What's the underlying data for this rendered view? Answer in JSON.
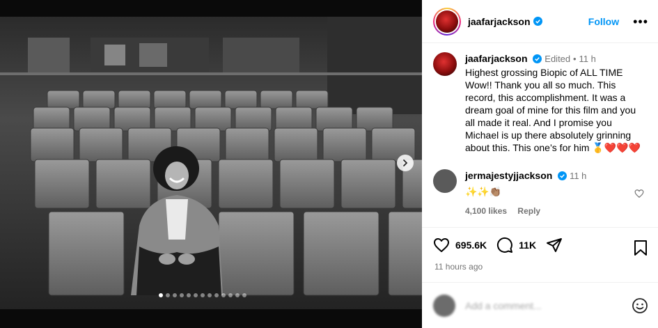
{
  "post": {
    "username": "jaafarjackson",
    "follow_label": "Follow",
    "more_label": "•••"
  },
  "caption": {
    "username": "jaafarjackson",
    "edited": "Edited",
    "separator": "•",
    "time": "11 h",
    "text": "Highest grossing Biopic of ALL TIME Wow!! Thank you all so much. This record, this accomplishment. It was a dream goal of mine for this film and you all made it real. And I promise you Michael is up there absolutely grinning about this. This one’s for him 🥇❤️❤️❤️"
  },
  "comment": {
    "username": "jermajestyjjackson",
    "time": "11 h",
    "text": "✨✨👏🏽",
    "likes": "4,100 likes",
    "reply_label": "Reply"
  },
  "actions": {
    "likes": "695.6K",
    "comments": "11K"
  },
  "timestamp": "11 hours ago",
  "add_comment": {
    "placeholder": "Add a comment..."
  },
  "carousel": {
    "slide_count": 13,
    "active_index": 0
  },
  "colors": {
    "accent": "#0095f6",
    "verified": "#0095f6",
    "muted": "#737373"
  }
}
